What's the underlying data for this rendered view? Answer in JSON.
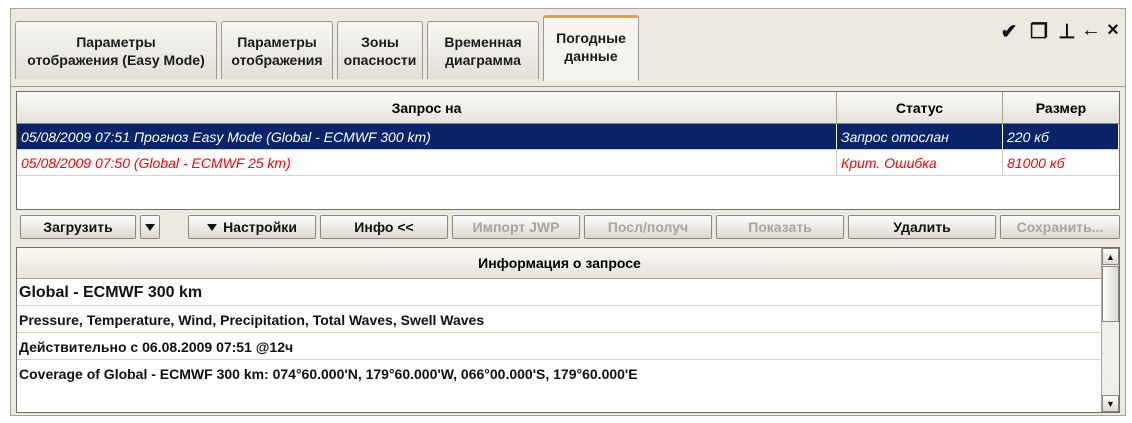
{
  "tabs": [
    {
      "label": "Параметры\nотображения (Easy Mode)",
      "active": false
    },
    {
      "label": "Параметры\nотображения",
      "active": false
    },
    {
      "label": "Зоны\nопасности",
      "active": false
    },
    {
      "label": "Временная\nдиаграмма",
      "active": false
    },
    {
      "label": "Погодные\nданные",
      "active": true
    }
  ],
  "window_controls": {
    "clean": "✔",
    "restore": "❐",
    "pin": "⊥",
    "back": "←",
    "close": "×"
  },
  "requests_table": {
    "columns": [
      "Запрос на",
      "Статус",
      "Размер"
    ],
    "rows": [
      {
        "request": "05/08/2009 07:51 Прогноз Easy Mode (Global - ECMWF 300 km)",
        "status": "Запрос отослан",
        "size": "220 кб",
        "selected": true
      },
      {
        "request": "05/08/2009 07:50 (Global - ECMWF 25 km)",
        "status": "Крит. Ошибка",
        "size": "81000 кб",
        "error": true
      }
    ]
  },
  "toolbar": {
    "load": "Загрузить",
    "settings": "Настройки",
    "info": "Инфо <<",
    "import_jwp": "Импорт JWP",
    "send_receive": "Посл/получ",
    "show": "Показать",
    "delete": "Удалить",
    "save": "Сохранить..."
  },
  "info_panel": {
    "header": "Информация о запросе",
    "title": "Global - ECMWF 300 km",
    "parameters": "Pressure, Temperature, Wind, Precipitation, Total Waves, Swell Waves",
    "valid": "Действительно с 06.08.2009 07:51 @12ч",
    "coverage": "Coverage of Global - ECMWF 300 km: 074°60.000'N, 179°60.000'W, 066°00.000'S, 179°60.000'E"
  },
  "colors": {
    "selection": "#0a246a",
    "error": "#ff0000",
    "active_tab_accent": "#f0a030"
  }
}
